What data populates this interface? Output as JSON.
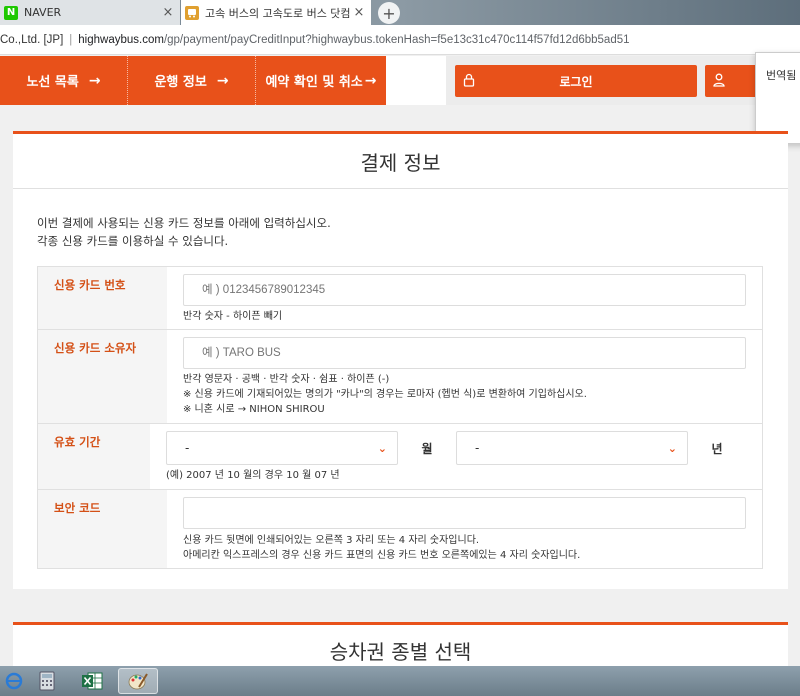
{
  "browser": {
    "tabs": [
      {
        "title": "NAVER",
        "favicon": "N",
        "active": false
      },
      {
        "title": "고속 버스의 고속도로 버스 닷컴",
        "favicon": "bus",
        "active": true
      }
    ],
    "close_glyph": "×",
    "new_tab_glyph": "+",
    "address": {
      "site_label": "Co.,Ltd. [JP]",
      "separator": "|",
      "host": "highwaybus.com",
      "path": "/gp/payment/payCreditInput?highwaybus.tokenHash=f5e13c31c470c114f57fd12d6bb5ad51"
    }
  },
  "site_nav": {
    "items": [
      {
        "label": "노선 목록",
        "arrow": "→"
      },
      {
        "label": "운행 정보",
        "arrow": "→"
      },
      {
        "label": "예약 확인 및 취소",
        "arrow": "→"
      }
    ],
    "login_label": "로그인",
    "accent_color": "#e8511a"
  },
  "translate_popup": {
    "text": "번역됨"
  },
  "payment_card": {
    "title": "결제 정보",
    "intro_line1": "이번 결제에 사용되는 신용 카드 정보를 아래에 입력하십시오.",
    "intro_line2": "각종 신용 카드를 이용하실 수 있습니다.",
    "card_number": {
      "label": "신용 카드 번호",
      "placeholder": "예 ) 0123456789012345",
      "hint": "반각 숫자 - 하이픈 빼기"
    },
    "card_holder": {
      "label": "신용 카드 소유자",
      "placeholder": "예 ) TARO BUS",
      "hint1": "반각 영문자 · 공백 · 반각 숫자 · 쉼표 · 하이픈 (-)",
      "hint2": "※ 신용 카드에 기재되어있는 명의가 \"카나\"의 경우는 로마자 (헵번 식)로 변환하여 기입하십시오.",
      "hint3": "※ 니혼 시로 → NIHON SHIROU"
    },
    "expiry": {
      "label": "유효 기간",
      "month_value": "-",
      "month_unit": "월",
      "year_value": "-",
      "year_unit": "년",
      "hint": "(예) 2007 년 10 월의 경우 10 월 07 년"
    },
    "security_code": {
      "label": "보안 코드",
      "placeholder": "",
      "hint1": "신용 카드 뒷면에 인쇄되어있는 오른쪽 3 자리 또는 4 자리 숫자입니다.",
      "hint2": "아메리칸 익스프레스의 경우 신용 카드 표면의 신용 카드 번호 오른쪽에있는 4 자리 숫자입니다."
    }
  },
  "ticket_card": {
    "title": "승차권 종별 선택"
  },
  "taskbar": {
    "icons": [
      "ie-icon",
      "calculator-icon",
      "excel-icon",
      "paint-icon"
    ]
  }
}
